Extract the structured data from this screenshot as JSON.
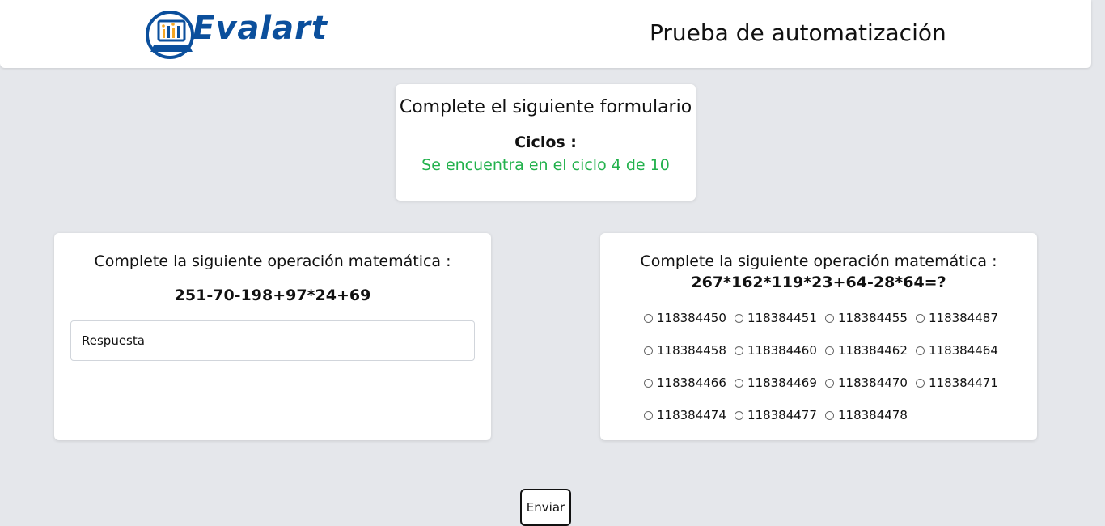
{
  "header": {
    "brand": "Evalart",
    "title": "Prueba de automatización"
  },
  "cycles": {
    "title": "Complete el siguiente formulario",
    "label": "Ciclos :",
    "status": "Se encuentra en el ciclo 4 de 10"
  },
  "left_question": {
    "title": "Complete la siguiente operación matemática :",
    "expression": "251-70-198+97*24+69",
    "input_placeholder": "Respuesta",
    "input_value": ""
  },
  "right_question": {
    "title": "Complete la siguiente operación matemática :",
    "expression": "267*162*119*23+64-28*64=?",
    "options": [
      "118384450",
      "118384451",
      "118384455",
      "118384487",
      "118384458",
      "118384460",
      "118384462",
      "118384464",
      "118384466",
      "118384469",
      "118384470",
      "118384471",
      "118384474",
      "118384477",
      "118384478"
    ]
  },
  "submit": {
    "label": "Enviar"
  },
  "colors": {
    "brand_blue": "#0b4f9c",
    "status_green": "#22b14c",
    "background": "#e5e7eb"
  },
  "icons": {
    "logo": "evalart-logo-icon"
  }
}
